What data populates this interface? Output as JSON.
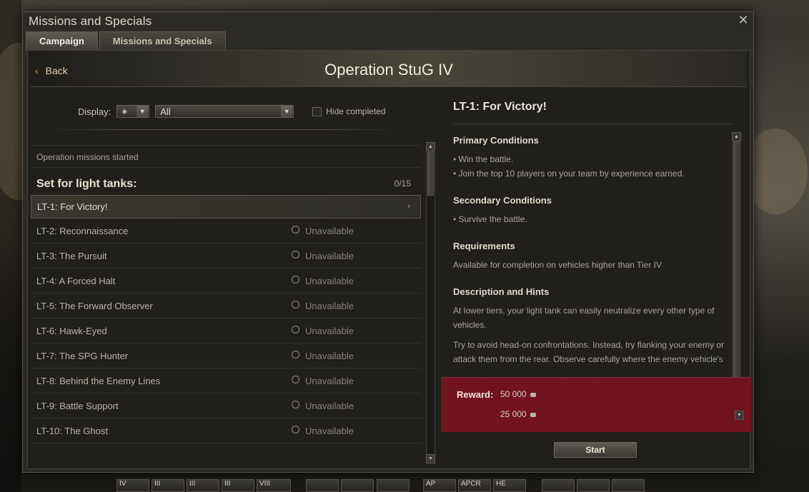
{
  "window": {
    "title": "Missions and Specials",
    "close_icon": "close-icon"
  },
  "tabs": [
    {
      "label": "Campaign",
      "active": true
    },
    {
      "label": "Missions and Specials",
      "active": false
    }
  ],
  "header": {
    "back_label": "Back",
    "operation_title": "Operation StuG IV"
  },
  "filters": {
    "display_label": "Display:",
    "type_select_icon": "vehicle-type-icon",
    "main_select_value": "All",
    "hide_completed_label": "Hide completed",
    "hide_completed_checked": false
  },
  "missions": {
    "status_text": "Operation missions started",
    "set_title": "Set for light tanks:",
    "set_count": "0/15",
    "items": [
      {
        "label": "LT-1: For Victory!",
        "status": "",
        "active": true
      },
      {
        "label": "LT-2: Reconnaissance",
        "status": "Unavailable",
        "active": false
      },
      {
        "label": "LT-3: The Pursuit",
        "status": "Unavailable",
        "active": false
      },
      {
        "label": "LT-4: A Forced Halt",
        "status": "Unavailable",
        "active": false
      },
      {
        "label": "LT-5: The Forward Observer",
        "status": "Unavailable",
        "active": false
      },
      {
        "label": "LT-6: Hawk-Eyed",
        "status": "Unavailable",
        "active": false
      },
      {
        "label": "LT-7: The SPG Hunter",
        "status": "Unavailable",
        "active": false
      },
      {
        "label": "LT-8: Behind the Enemy Lines",
        "status": "Unavailable",
        "active": false
      },
      {
        "label": "LT-9: Battle Support",
        "status": "Unavailable",
        "active": false
      },
      {
        "label": "LT-10: The Ghost",
        "status": "Unavailable",
        "active": false
      }
    ]
  },
  "detail": {
    "title": "LT-1: For Victory!",
    "primary_title": "Primary Conditions",
    "primary_items": [
      "Win the battle.",
      "Join the top 10 players on your team by experience earned."
    ],
    "secondary_title": "Secondary Conditions",
    "secondary_items": [
      "Survive the battle."
    ],
    "requirements_title": "Requirements",
    "requirements_text": "Available for completion on vehicles higher than Tier IV",
    "description_title": "Description and Hints",
    "description_p1": "At lower tiers, your light tank can easily neutralize every other type of vehicles.",
    "description_p2": "Try to avoid head-on confrontations. Instead, try flanking your enemy or attack them from the rear. Observe carefully where the enemy vehicle's",
    "reward_label": "Reward:",
    "reward_primary": "50 000",
    "reward_secondary": "25 000",
    "start_label": "Start"
  },
  "carousel": {
    "slots": [
      "IV",
      "III",
      "III",
      "III",
      "VIII",
      "",
      "",
      "",
      "AP",
      "APCR",
      "HE",
      "",
      "",
      ""
    ]
  }
}
